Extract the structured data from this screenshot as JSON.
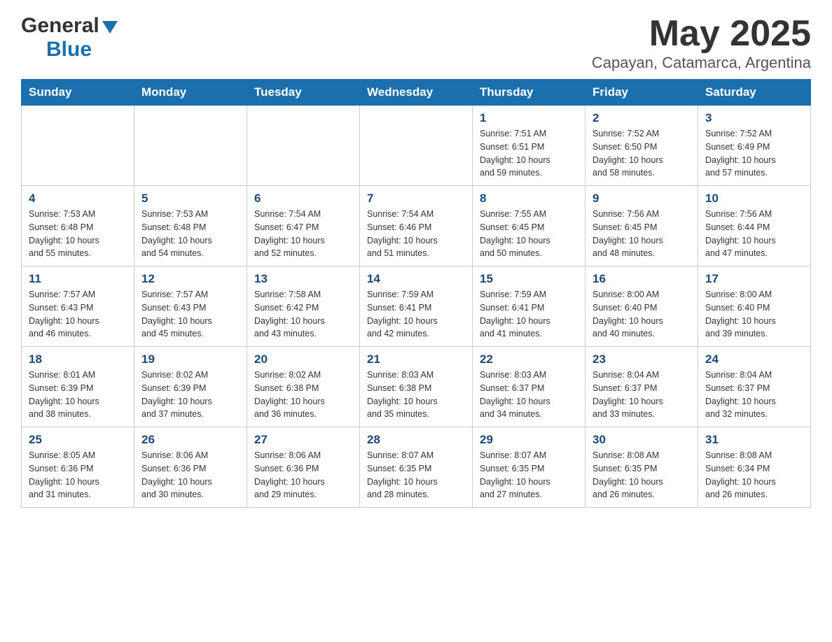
{
  "header": {
    "logo_general": "General",
    "logo_blue": "Blue",
    "title": "May 2025",
    "subtitle": "Capayan, Catamarca, Argentina"
  },
  "weekdays": [
    "Sunday",
    "Monday",
    "Tuesday",
    "Wednesday",
    "Thursday",
    "Friday",
    "Saturday"
  ],
  "weeks": [
    [
      {
        "day": "",
        "info": ""
      },
      {
        "day": "",
        "info": ""
      },
      {
        "day": "",
        "info": ""
      },
      {
        "day": "",
        "info": ""
      },
      {
        "day": "1",
        "info": "Sunrise: 7:51 AM\nSunset: 6:51 PM\nDaylight: 10 hours\nand 59 minutes."
      },
      {
        "day": "2",
        "info": "Sunrise: 7:52 AM\nSunset: 6:50 PM\nDaylight: 10 hours\nand 58 minutes."
      },
      {
        "day": "3",
        "info": "Sunrise: 7:52 AM\nSunset: 6:49 PM\nDaylight: 10 hours\nand 57 minutes."
      }
    ],
    [
      {
        "day": "4",
        "info": "Sunrise: 7:53 AM\nSunset: 6:48 PM\nDaylight: 10 hours\nand 55 minutes."
      },
      {
        "day": "5",
        "info": "Sunrise: 7:53 AM\nSunset: 6:48 PM\nDaylight: 10 hours\nand 54 minutes."
      },
      {
        "day": "6",
        "info": "Sunrise: 7:54 AM\nSunset: 6:47 PM\nDaylight: 10 hours\nand 52 minutes."
      },
      {
        "day": "7",
        "info": "Sunrise: 7:54 AM\nSunset: 6:46 PM\nDaylight: 10 hours\nand 51 minutes."
      },
      {
        "day": "8",
        "info": "Sunrise: 7:55 AM\nSunset: 6:45 PM\nDaylight: 10 hours\nand 50 minutes."
      },
      {
        "day": "9",
        "info": "Sunrise: 7:56 AM\nSunset: 6:45 PM\nDaylight: 10 hours\nand 48 minutes."
      },
      {
        "day": "10",
        "info": "Sunrise: 7:56 AM\nSunset: 6:44 PM\nDaylight: 10 hours\nand 47 minutes."
      }
    ],
    [
      {
        "day": "11",
        "info": "Sunrise: 7:57 AM\nSunset: 6:43 PM\nDaylight: 10 hours\nand 46 minutes."
      },
      {
        "day": "12",
        "info": "Sunrise: 7:57 AM\nSunset: 6:43 PM\nDaylight: 10 hours\nand 45 minutes."
      },
      {
        "day": "13",
        "info": "Sunrise: 7:58 AM\nSunset: 6:42 PM\nDaylight: 10 hours\nand 43 minutes."
      },
      {
        "day": "14",
        "info": "Sunrise: 7:59 AM\nSunset: 6:41 PM\nDaylight: 10 hours\nand 42 minutes."
      },
      {
        "day": "15",
        "info": "Sunrise: 7:59 AM\nSunset: 6:41 PM\nDaylight: 10 hours\nand 41 minutes."
      },
      {
        "day": "16",
        "info": "Sunrise: 8:00 AM\nSunset: 6:40 PM\nDaylight: 10 hours\nand 40 minutes."
      },
      {
        "day": "17",
        "info": "Sunrise: 8:00 AM\nSunset: 6:40 PM\nDaylight: 10 hours\nand 39 minutes."
      }
    ],
    [
      {
        "day": "18",
        "info": "Sunrise: 8:01 AM\nSunset: 6:39 PM\nDaylight: 10 hours\nand 38 minutes."
      },
      {
        "day": "19",
        "info": "Sunrise: 8:02 AM\nSunset: 6:39 PM\nDaylight: 10 hours\nand 37 minutes."
      },
      {
        "day": "20",
        "info": "Sunrise: 8:02 AM\nSunset: 6:38 PM\nDaylight: 10 hours\nand 36 minutes."
      },
      {
        "day": "21",
        "info": "Sunrise: 8:03 AM\nSunset: 6:38 PM\nDaylight: 10 hours\nand 35 minutes."
      },
      {
        "day": "22",
        "info": "Sunrise: 8:03 AM\nSunset: 6:37 PM\nDaylight: 10 hours\nand 34 minutes."
      },
      {
        "day": "23",
        "info": "Sunrise: 8:04 AM\nSunset: 6:37 PM\nDaylight: 10 hours\nand 33 minutes."
      },
      {
        "day": "24",
        "info": "Sunrise: 8:04 AM\nSunset: 6:37 PM\nDaylight: 10 hours\nand 32 minutes."
      }
    ],
    [
      {
        "day": "25",
        "info": "Sunrise: 8:05 AM\nSunset: 6:36 PM\nDaylight: 10 hours\nand 31 minutes."
      },
      {
        "day": "26",
        "info": "Sunrise: 8:06 AM\nSunset: 6:36 PM\nDaylight: 10 hours\nand 30 minutes."
      },
      {
        "day": "27",
        "info": "Sunrise: 8:06 AM\nSunset: 6:36 PM\nDaylight: 10 hours\nand 29 minutes."
      },
      {
        "day": "28",
        "info": "Sunrise: 8:07 AM\nSunset: 6:35 PM\nDaylight: 10 hours\nand 28 minutes."
      },
      {
        "day": "29",
        "info": "Sunrise: 8:07 AM\nSunset: 6:35 PM\nDaylight: 10 hours\nand 27 minutes."
      },
      {
        "day": "30",
        "info": "Sunrise: 8:08 AM\nSunset: 6:35 PM\nDaylight: 10 hours\nand 26 minutes."
      },
      {
        "day": "31",
        "info": "Sunrise: 8:08 AM\nSunset: 6:34 PM\nDaylight: 10 hours\nand 26 minutes."
      }
    ]
  ]
}
